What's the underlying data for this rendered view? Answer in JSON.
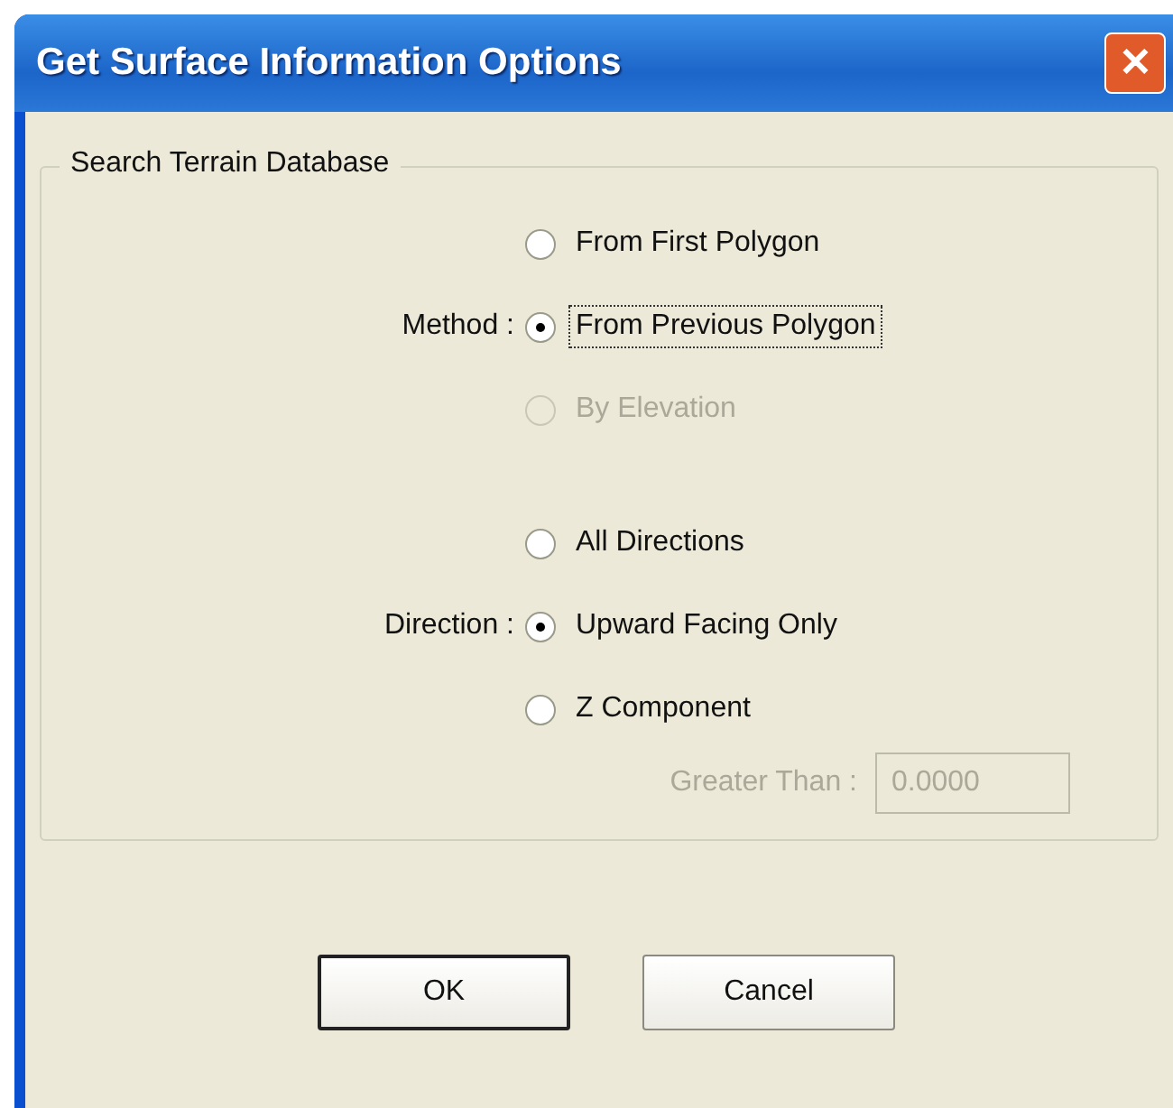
{
  "window": {
    "title": "Get Surface Information Options",
    "close_label": "✕"
  },
  "group": {
    "title": "Search Terrain Database",
    "settings": [
      {
        "label": "Method :",
        "options": [
          {
            "label": "From First Polygon",
            "selected": false,
            "disabled": false,
            "focused": false
          },
          {
            "label": "From Previous Polygon",
            "selected": true,
            "disabled": false,
            "focused": true
          },
          {
            "label": "By Elevation",
            "selected": false,
            "disabled": true,
            "focused": false
          }
        ]
      },
      {
        "label": "Direction :",
        "options": [
          {
            "label": "All Directions",
            "selected": false,
            "disabled": false,
            "focused": false
          },
          {
            "label": "Upward Facing Only",
            "selected": true,
            "disabled": false,
            "focused": false
          },
          {
            "label": "Z Component",
            "selected": false,
            "disabled": false,
            "focused": false
          }
        ]
      }
    ],
    "threshold": {
      "label": "Greater Than :",
      "value": "0.0000",
      "disabled": true
    }
  },
  "buttons": [
    {
      "label": "OK",
      "default": true
    },
    {
      "label": "Cancel",
      "default": false
    }
  ]
}
